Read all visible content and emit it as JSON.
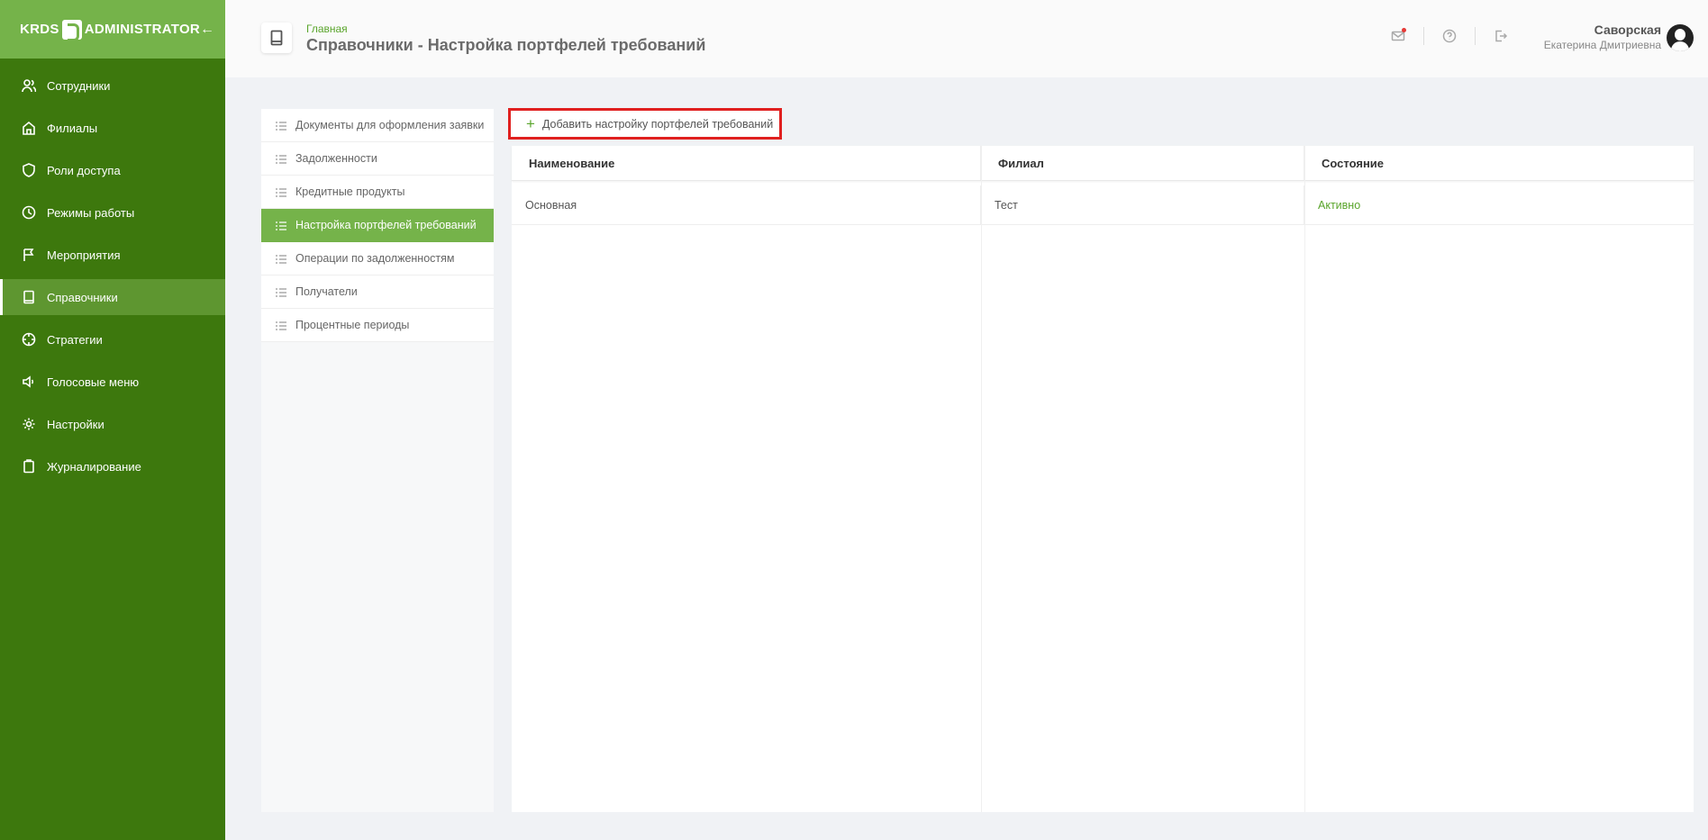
{
  "app": {
    "logo_left": "KRDS",
    "logo_right": "ADMINISTRATOR"
  },
  "sidebar": {
    "items": [
      {
        "label": "Сотрудники",
        "icon": "users-icon"
      },
      {
        "label": "Филиалы",
        "icon": "home-icon"
      },
      {
        "label": "Роли доступа",
        "icon": "shield-icon"
      },
      {
        "label": "Режимы работы",
        "icon": "clock-icon"
      },
      {
        "label": "Мероприятия",
        "icon": "flag-icon"
      },
      {
        "label": "Справочники",
        "icon": "book-icon",
        "active": true
      },
      {
        "label": "Стратегии",
        "icon": "crosshair-icon"
      },
      {
        "label": "Голосовые меню",
        "icon": "speaker-icon"
      },
      {
        "label": "Настройки",
        "icon": "gear-icon"
      },
      {
        "label": "Журналирование",
        "icon": "clipboard-icon"
      }
    ]
  },
  "header": {
    "breadcrumb": "Главная",
    "title": "Справочники - Настройка портфелей требований",
    "user_last": "Саворская",
    "user_first": "Екатерина Дмитриевна"
  },
  "dictionaries": {
    "items": [
      {
        "label": "Документы для оформления заявки"
      },
      {
        "label": "Задолженности"
      },
      {
        "label": "Кредитные продукты"
      },
      {
        "label": "Настройка портфелей требований",
        "active": true
      },
      {
        "label": "Операции по задолженностям"
      },
      {
        "label": "Получатели"
      },
      {
        "label": "Процентные периоды"
      }
    ]
  },
  "toolbar": {
    "add_label": "Добавить настройку портфелей требований"
  },
  "table": {
    "columns": [
      "Наименование",
      "Филиал",
      "Состояние"
    ],
    "rows": [
      [
        "Основная",
        "Тест",
        "Активно"
      ]
    ]
  },
  "colors": {
    "accent": "#75b34a",
    "sidebar": "#3d780d",
    "status_active": "#5aa52c",
    "highlight": "#e0201f"
  }
}
